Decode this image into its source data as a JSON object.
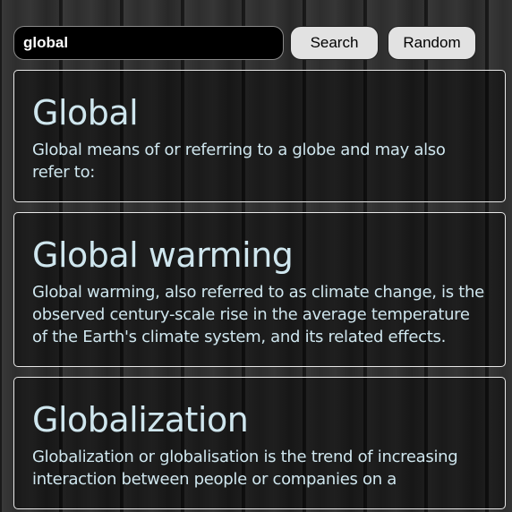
{
  "search": {
    "value": "global",
    "search_label": "Search",
    "random_label": "Random"
  },
  "results": [
    {
      "title": "Global",
      "description": "Global means of or referring to a globe and may also refer to:"
    },
    {
      "title": "Global warming",
      "description": "Global warming, also referred to as climate change, is the observed century-scale rise in the average temperature of the Earth's climate system, and its related effects."
    },
    {
      "title": "Globalization",
      "description": "Globalization or globalisation is the trend of increasing interaction between people or companies on a"
    }
  ]
}
